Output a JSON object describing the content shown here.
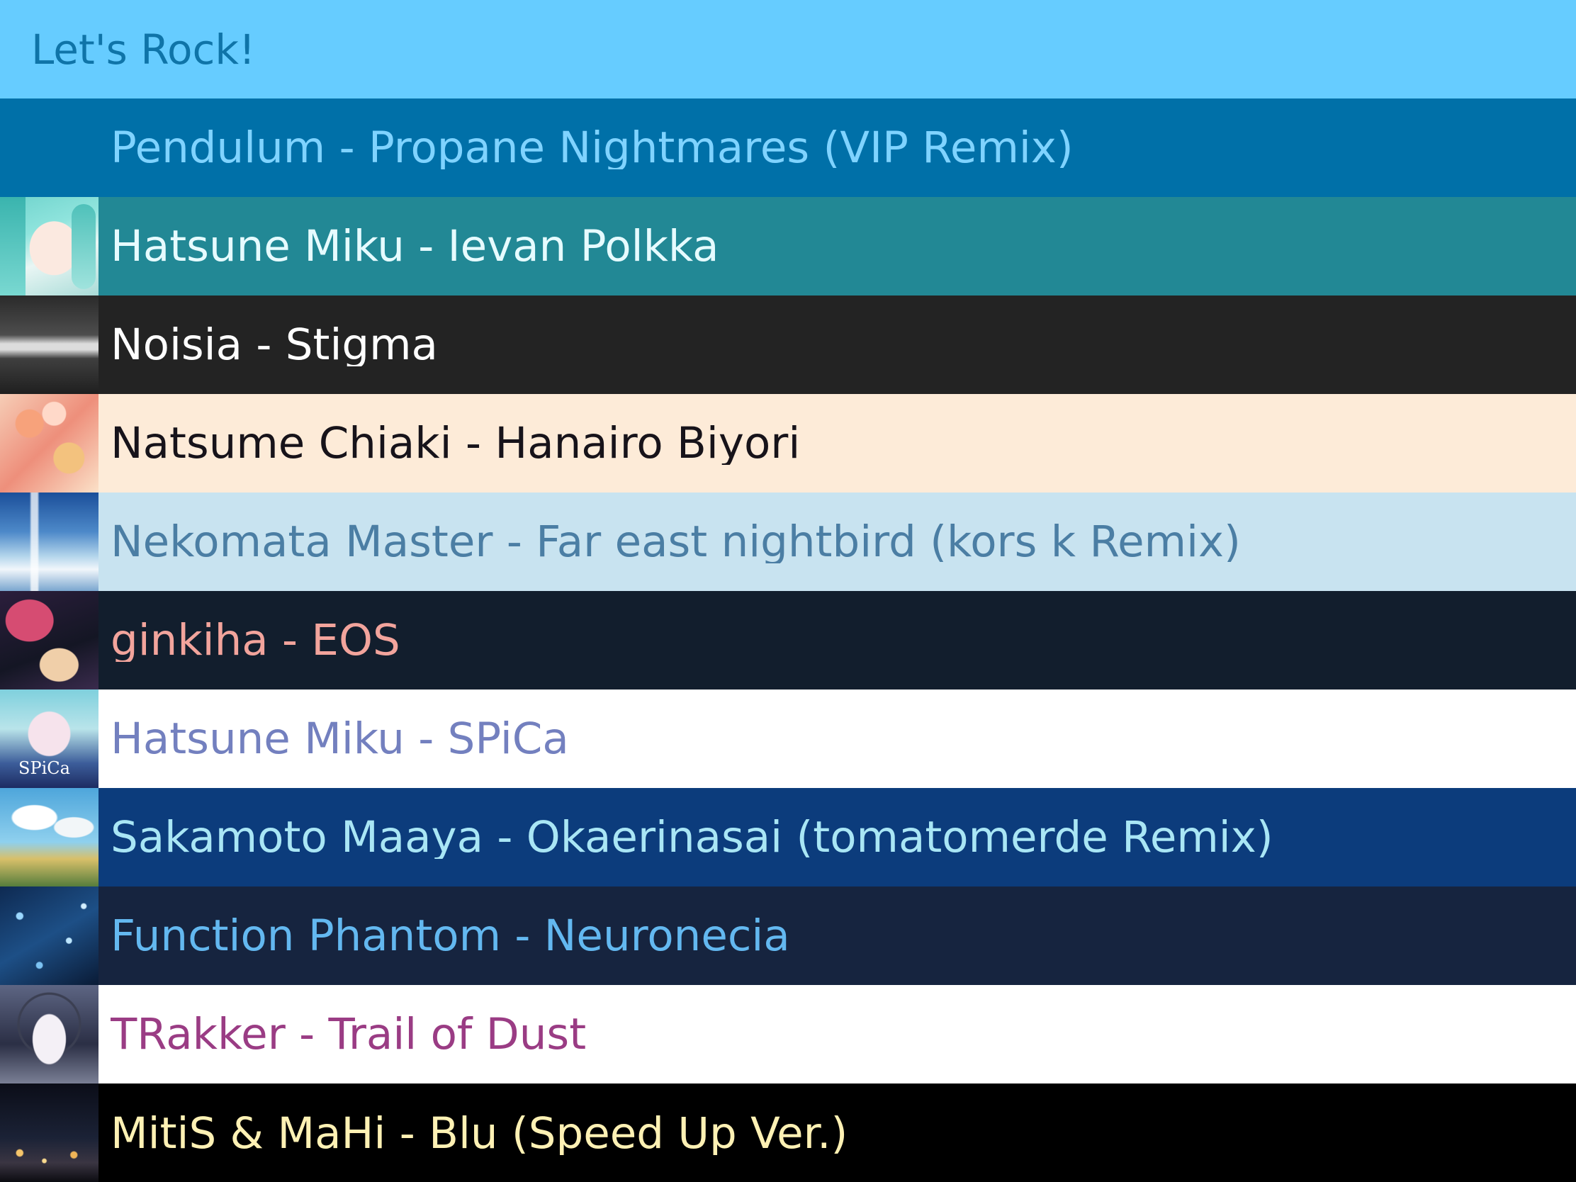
{
  "header": {
    "title": "Let's Rock!",
    "background": "#66ccff",
    "text_color": "#0f74a8"
  },
  "tracks": [
    {
      "title": "Pendulum - Propane Nightmares (VIP Remix)",
      "artwork": "none",
      "background": "#0070a8",
      "text_color": "#7fd3ff"
    },
    {
      "title": "Hatsune Miku - Ievan Polkka",
      "artwork": "album-art-hatsune-miku-ievan-polkka",
      "background": "#228895",
      "text_color": "#e6fbff"
    },
    {
      "title": "Noisia - Stigma",
      "artwork": "album-art-noisia-stigma",
      "background": "#232323",
      "text_color": "#ffffff"
    },
    {
      "title": "Natsume Chiaki - Hanairo Biyori",
      "artwork": "album-art-natsume-chiaki-hanairo-biyori",
      "background": "#fdebd8",
      "text_color": "#17131a"
    },
    {
      "title": "Nekomata Master - Far east nightbird (kors k Remix)",
      "artwork": "album-art-nekomata-master-far-east-nightbird",
      "background": "#c8e3f0",
      "text_color": "#4b7ea4"
    },
    {
      "title": "ginkiha - EOS",
      "artwork": "album-art-ginkiha-eos",
      "background": "#121e2d",
      "text_color": "#f2a49c"
    },
    {
      "title": "Hatsune Miku - SPiCa",
      "artwork": "album-art-hatsune-miku-spica",
      "background": "#ffffff",
      "text_color": "#7380bf"
    },
    {
      "title": "Sakamoto Maaya - Okaerinasai (tomatomerde Remix)",
      "artwork": "album-art-sakamoto-maaya-okaerinasai",
      "background": "#0c3c7c",
      "text_color": "#a9e6f5"
    },
    {
      "title": "Function Phantom - Neuronecia",
      "artwork": "album-art-function-phantom-neuronecia",
      "background": "#16243f",
      "text_color": "#63b8f0"
    },
    {
      "title": "TRakker - Trail of Dust",
      "artwork": "album-art-trakker-trail-of-dust",
      "background": "#ffffff",
      "text_color": "#9a3c84"
    },
    {
      "title": "MitiS & MaHi - Blu (Speed Up Ver.)",
      "artwork": "album-art-mitis-mahi-blu",
      "background": "#000000",
      "text_color": "#fff1b4"
    }
  ]
}
